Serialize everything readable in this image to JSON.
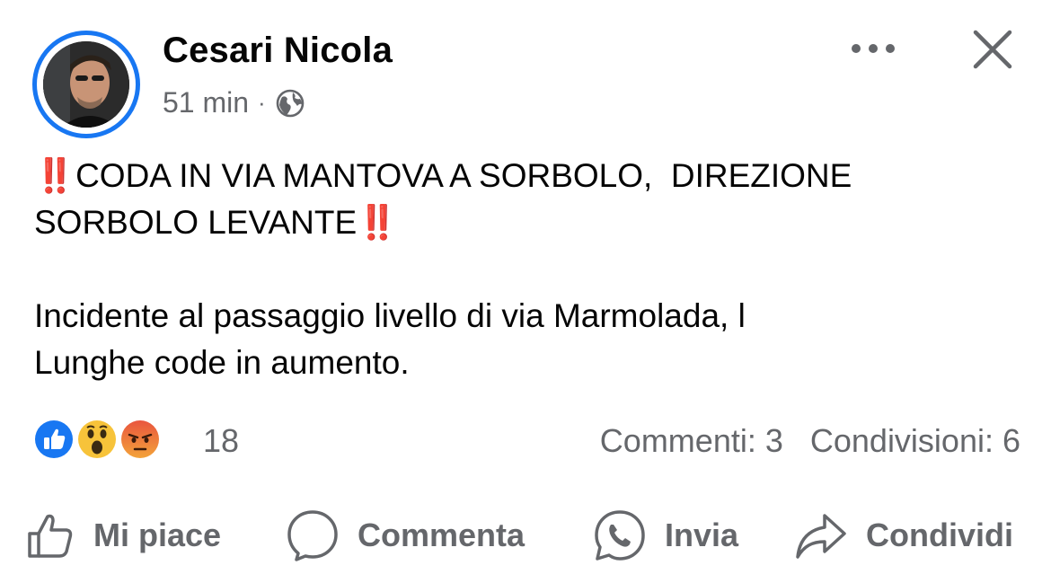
{
  "post": {
    "author": "Cesari Nicola",
    "time": "51 min",
    "separator": "·",
    "privacy_icon": "globe-icon",
    "headline_mark": "‼️",
    "headline_line1": "CODA IN VIA MANTOVA A SORBOLO,  DIREZIONE",
    "headline_line2": "SORBOLO LEVANTE",
    "body_line1": "Incidente al passaggio livello di via Marmolada, l",
    "body_line2": "Lunghe code in aumento."
  },
  "reactions": {
    "types": [
      "like-reaction-icon",
      "wow-reaction-icon",
      "angry-reaction-icon"
    ],
    "count": "18",
    "comments": "Commenti: 3",
    "shares": "Condivisioni: 6"
  },
  "actions": {
    "like": "Mi piace",
    "comment": "Commenta",
    "send": "Invia",
    "share": "Condividi"
  },
  "colors": {
    "accent": "#1877f2",
    "secondary_text": "#65676b",
    "alert": "#e0141e"
  }
}
